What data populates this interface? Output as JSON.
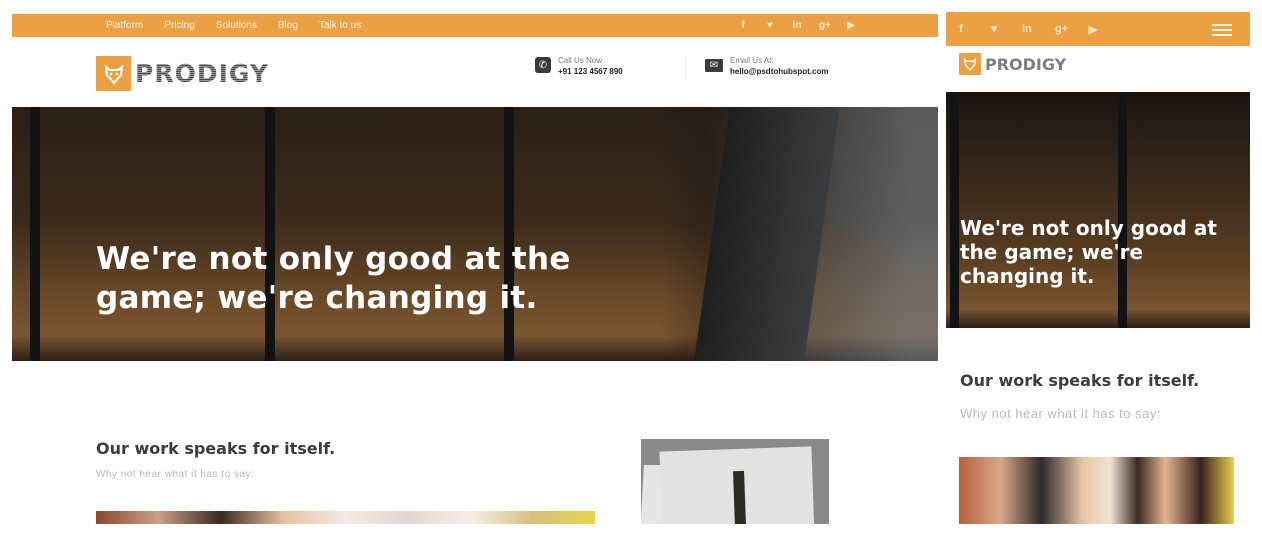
{
  "desktop": {
    "topbar": {
      "nav": [
        "Platform",
        "Pricing",
        "Solutions",
        "Blog",
        "Talk to us"
      ],
      "social_icons": [
        {
          "name": "facebook-icon",
          "glyph": "f"
        },
        {
          "name": "twitter-icon",
          "glyph": "♥"
        },
        {
          "name": "linkedin-icon",
          "glyph": "in"
        },
        {
          "name": "google-plus-icon",
          "glyph": "g+"
        },
        {
          "name": "youtube-icon",
          "glyph": "▶"
        }
      ]
    },
    "header": {
      "logo_text": "PRODIGY",
      "logo_icon": "tiger-icon",
      "call": {
        "label": "Call Us Now",
        "value": "+91 123 4567 890",
        "icon": "phone-icon"
      },
      "email": {
        "label": "Email Us At:",
        "value": "hello@psdtohubspot.com",
        "icon": "envelope-icon"
      }
    },
    "hero": {
      "title_line1": "We're not only good at the",
      "title_line2": "game; we're changing it."
    },
    "section": {
      "title": "Our work speaks for itself.",
      "subtitle": "Why not hear what it has to say:"
    }
  },
  "mobile": {
    "topbar": {
      "social_icons": [
        {
          "name": "facebook-icon",
          "glyph": "f"
        },
        {
          "name": "twitter-icon",
          "glyph": "♥"
        },
        {
          "name": "linkedin-icon",
          "glyph": "in"
        },
        {
          "name": "google-plus-icon",
          "glyph": "g+"
        },
        {
          "name": "youtube-icon",
          "glyph": "▶"
        }
      ],
      "menu_icon": "hamburger-menu-icon"
    },
    "header": {
      "logo_text": "PRODIGY"
    },
    "hero": {
      "title_line1": "We're not only good at",
      "title_line2": "the game; we're",
      "title_line3": "changing it."
    },
    "section": {
      "title": "Our work speaks for itself.",
      "subtitle": "Why not hear what it has to say:"
    }
  },
  "colors": {
    "brand_orange": "#eca044",
    "heading": "#3c3c3c",
    "subtext": "#b9b9b9"
  }
}
